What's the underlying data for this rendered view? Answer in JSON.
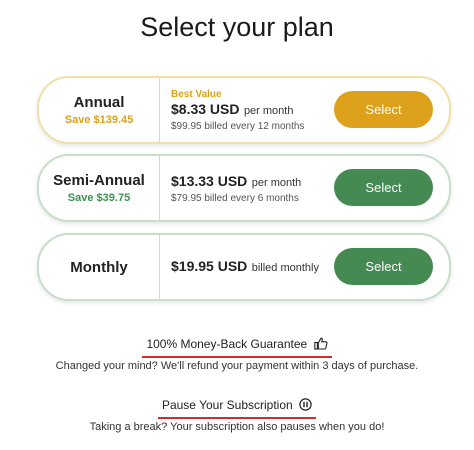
{
  "page": {
    "title": "Select your plan"
  },
  "plans": [
    {
      "name": "Annual",
      "save": "Save $139.45",
      "badge": "Best Value",
      "price": "$8.33 USD",
      "price_suffix": "per month",
      "billed": "$99.95 billed every 12 months",
      "button_label": "Select"
    },
    {
      "name": "Semi-Annual",
      "save": "Save $39.75",
      "price": "$13.33 USD",
      "price_suffix": "per month",
      "billed": "$79.95 billed every 6 months",
      "button_label": "Select"
    },
    {
      "name": "Monthly",
      "price": "$19.95 USD",
      "price_suffix": "billed monthly",
      "button_label": "Select"
    }
  ],
  "guarantee": {
    "title": "100% Money-Back Guarantee",
    "icon": "thumbs-up-icon",
    "text": "Changed your mind? We'll refund your payment within 3 days of purchase."
  },
  "pause": {
    "title": "Pause Your Subscription",
    "icon": "pause-circle-icon",
    "text": "Taking a break? Your subscription also pauses when you do!"
  },
  "colors": {
    "gold": "#dda11c",
    "green": "#458a52",
    "underline_red": "#d62b2b"
  }
}
